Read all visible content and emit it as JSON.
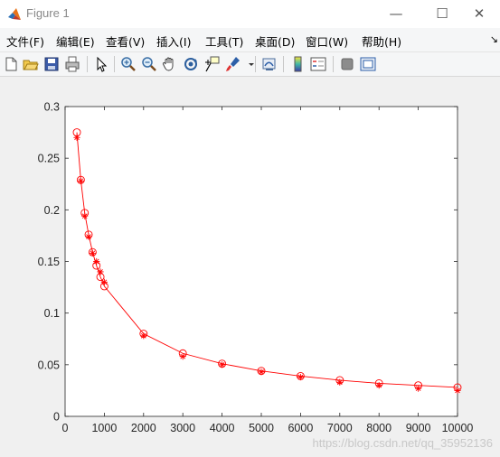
{
  "window": {
    "title": "Figure 1",
    "minimize_glyph": "—",
    "maximize_glyph": "☐",
    "close_glyph": "✕"
  },
  "menu": {
    "items": [
      "文件(F)",
      "编辑(E)",
      "查看(V)",
      "插入(I)",
      "工具(T)",
      "桌面(D)",
      "窗口(W)",
      "帮助(H)"
    ],
    "overflow_glyph": "↘"
  },
  "toolbar": {
    "icons": [
      "new-figure-icon",
      "open-file-icon",
      "save-icon",
      "print-icon",
      "edit-plot-arrow-icon",
      "zoom-in-icon",
      "zoom-out-icon",
      "pan-hand-icon",
      "rotate-3d-icon",
      "data-cursor-icon",
      "brush-icon",
      "link-plot-icon",
      "colorbar-icon",
      "legend-icon",
      "hide-plot-tools-icon",
      "show-plot-tools-icon"
    ]
  },
  "chart_data": {
    "type": "line",
    "xlim": [
      0,
      10000
    ],
    "ylim": [
      0,
      0.3
    ],
    "xticks": [
      0,
      1000,
      2000,
      3000,
      4000,
      5000,
      6000,
      7000,
      8000,
      9000,
      10000
    ],
    "xtick_labels": [
      "0",
      "1000",
      "2000",
      "3000",
      "4000",
      "5000",
      "6000",
      "7000",
      "8000",
      "9000",
      "10000"
    ],
    "yticks": [
      0,
      0.05,
      0.1,
      0.15,
      0.2,
      0.25,
      0.3
    ],
    "ytick_labels": [
      "0",
      "0.05",
      "0.1",
      "0.15",
      "0.2",
      "0.25",
      "0.3"
    ],
    "grid": false,
    "color": "#ff0000",
    "series": [
      {
        "marker": "o",
        "line": true,
        "x": [
          300,
          400,
          500,
          600,
          700,
          800,
          900,
          1000,
          2000,
          3000,
          4000,
          5000,
          6000,
          7000,
          8000,
          9000,
          10000
        ],
        "values": [
          0.275,
          0.229,
          0.197,
          0.176,
          0.159,
          0.146,
          0.135,
          0.126,
          0.08,
          0.061,
          0.051,
          0.044,
          0.039,
          0.035,
          0.032,
          0.03,
          0.028
        ]
      },
      {
        "marker": "*",
        "line": false,
        "x": [
          300,
          400,
          500,
          600,
          700,
          800,
          900,
          1000,
          2000,
          3000,
          4000,
          5000,
          6000,
          7000,
          8000,
          9000,
          10000
        ],
        "values": [
          0.27,
          0.228,
          0.194,
          0.174,
          0.158,
          0.15,
          0.14,
          0.13,
          0.078,
          0.058,
          0.05,
          0.043,
          0.038,
          0.033,
          0.03,
          0.027,
          0.025
        ]
      }
    ]
  },
  "watermark": "https://blog.csdn.net/qq_35952136"
}
